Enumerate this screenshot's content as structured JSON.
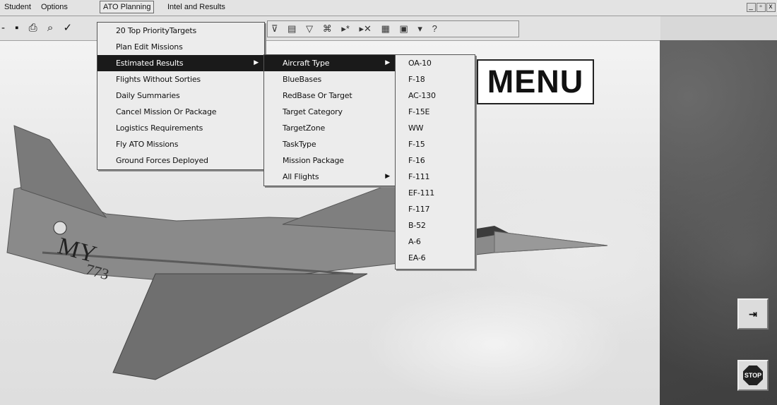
{
  "menubar": {
    "items": [
      "Student",
      "Options",
      "ATO Planning",
      "Intel and Results"
    ],
    "window_controls": [
      "_",
      "▫",
      "x"
    ]
  },
  "toolbar": {
    "left_icons": [
      "dash-icon",
      "save-icon",
      "print-icon",
      "print-preview-icon",
      "spellcheck-icon"
    ],
    "right_icons": [
      "filter-select-icon",
      "filter-by-form-icon",
      "apply-filter-icon",
      "find-icon",
      "new-record-icon",
      "delete-record-icon",
      "database-window-icon",
      "new-object-icon",
      "help-icon"
    ]
  },
  "menus": {
    "level1": [
      {
        "label": "20 Top PriorityTargets"
      },
      {
        "label": "Plan Edit Missions"
      },
      {
        "label": "Estimated Results",
        "selected": true,
        "submenu": true
      },
      {
        "label": "Flights Without Sorties"
      },
      {
        "label": "Daily Summaries"
      },
      {
        "label": "Cancel Mission Or Package"
      },
      {
        "label": "Logistics Requirements"
      },
      {
        "label": "Fly ATO Missions"
      },
      {
        "label": "Ground Forces Deployed"
      }
    ],
    "level2": [
      {
        "label": "Aircraft Type",
        "selected": true,
        "submenu": true
      },
      {
        "label": "BlueBases"
      },
      {
        "label": "RedBase Or Target"
      },
      {
        "label": "Target Category"
      },
      {
        "label": "TargetZone"
      },
      {
        "label": "TaskType"
      },
      {
        "label": "Mission Package"
      },
      {
        "label": "All Flights",
        "submenu": true
      }
    ],
    "level3": [
      {
        "label": "OA-10"
      },
      {
        "label": "F-18"
      },
      {
        "label": "AC-130"
      },
      {
        "label": "F-15E"
      },
      {
        "label": "WW"
      },
      {
        "label": "F-15"
      },
      {
        "label": "F-16"
      },
      {
        "label": "F-111"
      },
      {
        "label": "EF-111"
      },
      {
        "label": "F-117"
      },
      {
        "label": "B-52"
      },
      {
        "label": "A-6"
      },
      {
        "label": "EA-6"
      }
    ]
  },
  "callout": {
    "text": "MENU"
  },
  "jet": {
    "tail_code": "MY",
    "tail_number": "773"
  },
  "right_panel": {
    "exit_icon": "exit-door-icon",
    "stop_label": "STOP"
  }
}
